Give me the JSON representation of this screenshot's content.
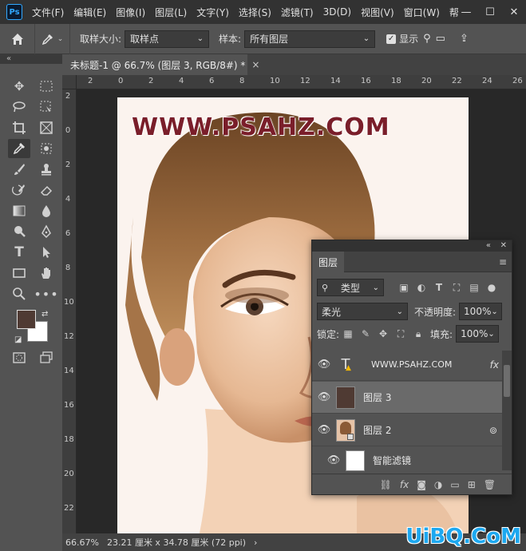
{
  "app": {
    "logo": "Ps"
  },
  "menu": [
    "文件(F)",
    "编辑(E)",
    "图像(I)",
    "图层(L)",
    "文字(Y)",
    "选择(S)",
    "滤镜(T)",
    "3D(D)",
    "视图(V)",
    "窗口(W)",
    "帮"
  ],
  "window_controls": {
    "minimize": "—",
    "maximize": "☐",
    "close": "✕"
  },
  "options": {
    "sample_size_label": "取样大小:",
    "sample_size_value": "取样点",
    "sample_label": "样本:",
    "sample_value": "所有图层",
    "show_label": "显示"
  },
  "document_tab": {
    "title": "未标题-1 @ 66.7% (图层 3, RGB/8#) *",
    "close": "×"
  },
  "toolbar": {
    "collapse": "«"
  },
  "ruler": {
    "h": [
      "2",
      "0",
      "2",
      "4",
      "6",
      "8",
      "10",
      "12",
      "14",
      "16",
      "18",
      "20",
      "22",
      "24",
      "26"
    ],
    "v": [
      "2",
      "0",
      "2",
      "4",
      "6",
      "8",
      "10",
      "12",
      "14",
      "16",
      "18",
      "20",
      "22"
    ]
  },
  "canvas": {
    "watermark": "WWW.PSAHZ.COM",
    "fg_color": "#4f3a33",
    "bg_color": "#ffffff"
  },
  "status": {
    "zoom": "66.67%",
    "doc_info": "23.21 厘米 x 34.78 厘米 (72 ppi)",
    "arrow": "›"
  },
  "site_mark": "UiBQ.CoM",
  "layers_panel": {
    "collapse": "«",
    "close": "✕",
    "title": "图层",
    "filter_value": "类型",
    "blend_mode": "柔光",
    "opacity_label": "不透明度:",
    "opacity_value": "100%",
    "lock_label": "锁定:",
    "fill_label": "填充:",
    "fill_value": "100%",
    "layers": [
      {
        "name": "WWW.PSAHZ.COM",
        "type": "text",
        "fx": "fx"
      },
      {
        "name": "图层 3",
        "type": "color",
        "color": "#4f3a33"
      },
      {
        "name": "图层 2",
        "type": "smart"
      },
      {
        "name": "智能滤镜",
        "type": "filter"
      }
    ],
    "bottom_icons": [
      "link-icon",
      "fx-icon",
      "mask-icon",
      "adjustment-icon",
      "group-icon",
      "new-layer-icon",
      "trash-icon"
    ]
  }
}
